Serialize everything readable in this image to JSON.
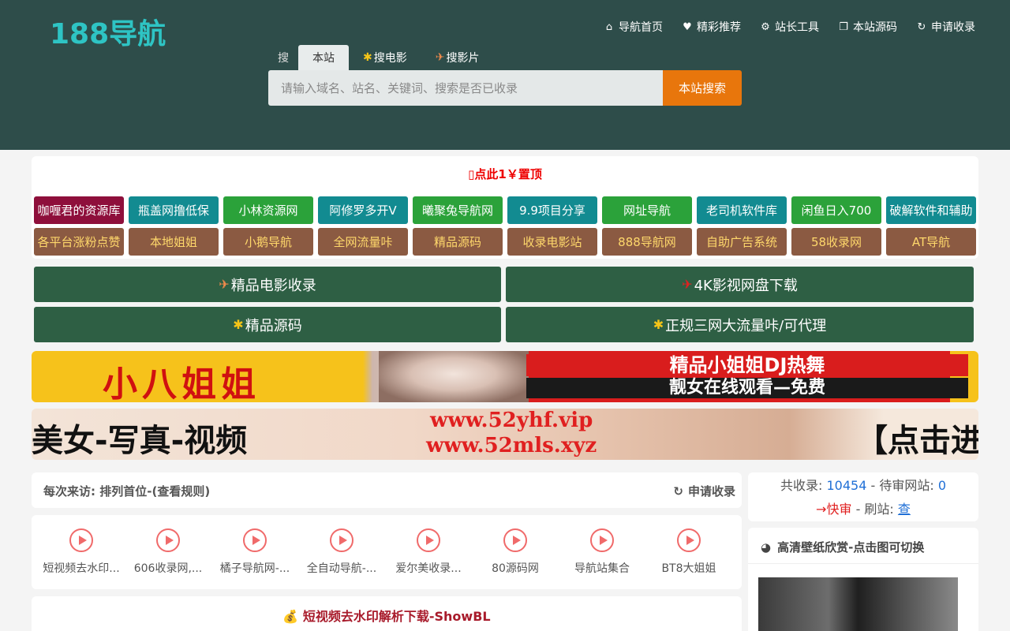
{
  "logo": "188导航",
  "nav": [
    {
      "icon": "home-icon",
      "glyph": "⌂",
      "label": "导航首页"
    },
    {
      "icon": "heart-icon",
      "glyph": "♥",
      "label": "精彩推荐"
    },
    {
      "icon": "gears-icon",
      "glyph": "⚙",
      "label": "站长工具"
    },
    {
      "icon": "window-icon",
      "glyph": "❐",
      "label": "本站源码"
    },
    {
      "icon": "refresh-icon",
      "glyph": "↻",
      "label": "申请收录"
    }
  ],
  "search": {
    "lead": "搜",
    "tabs": [
      "本站",
      "搜电影",
      "搜影片"
    ],
    "placeholder": "请输入域名、站名、关键词、搜索是否已收录",
    "button": "本站搜索"
  },
  "promo": {
    "title": "点此1￥置顶",
    "row1": [
      {
        "label": "咖喱君的资源库",
        "color": "#8e0f3b"
      },
      {
        "label": "瓶盖网撸低保",
        "color": "#128b91"
      },
      {
        "label": "小林资源网",
        "color": "#2ba23a"
      },
      {
        "label": "阿修罗多开V",
        "color": "#128b91"
      },
      {
        "label": "曦聚兔导航网",
        "color": "#2ba23a"
      },
      {
        "label": "9.9项目分享",
        "color": "#128b91"
      },
      {
        "label": "网址导航",
        "color": "#2ba23a"
      },
      {
        "label": "老司机软件库",
        "color": "#128b91"
      },
      {
        "label": "闲鱼日入700",
        "color": "#2ba23a"
      },
      {
        "label": "破解软件和辅助",
        "color": "#128b91"
      }
    ],
    "row2": [
      "各平台涨粉点赞",
      "本地姐姐",
      "小鹅导航",
      "全网流量咔",
      "精品源码",
      "收录电影站",
      "888导航网",
      "自助广告系统",
      "58收录网",
      "AT导航"
    ],
    "row2_color": "#8b5a42"
  },
  "big_buttons": [
    "精品电影收录",
    "4K影视网盘下载",
    "精品源码",
    "正规三网大流量咔/可代理"
  ],
  "banner1": {
    "left": "小八姐姐",
    "right_top": "精品小姐姐DJ热舞",
    "right_bottom": "靓女在线观看—免费"
  },
  "banner2": {
    "left": "美女-写真-视频",
    "url1": "www.52yhf.vip",
    "url2": "www.52mls.xyz",
    "right": "【点击进入"
  },
  "visit": {
    "prefix": "每次来访:",
    "rule": "排列首位-(查看规则)",
    "apply": "申请收录"
  },
  "sites": [
    "短视频去水印...",
    "606收录网,...",
    "橘子导航网-...",
    "全自动导航-...",
    "爱尔美收录...",
    "80源码网",
    "导航站集合",
    "BT8大姐姐"
  ],
  "article_title": "短视频去水印解析下载-ShowBL",
  "stats": {
    "total_label": "共收录:",
    "total": "10454",
    "pending_label": "- 待审网站:",
    "pending": "0",
    "fast": "→快审",
    "brush_label": "- 刷站:",
    "check": "查"
  },
  "wallpaper_title": "高清壁纸欣赏-点击图可切换"
}
